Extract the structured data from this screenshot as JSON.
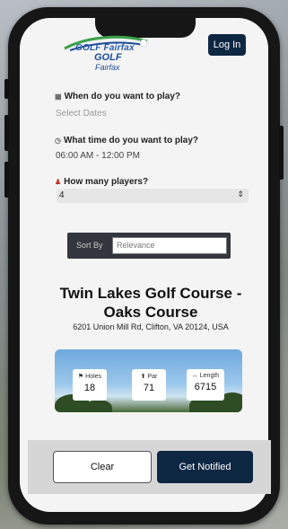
{
  "header": {
    "logo_line1": "GOLF Fairfax",
    "logo_line2": "GOLF",
    "logo_line3": "Fairfax",
    "login_label": "Log In"
  },
  "form": {
    "date_label": "When do you want to play?",
    "date_placeholder": "Select Dates",
    "time_label": "What time do you want to play?",
    "time_value": "06:00 AM - 12:00 PM",
    "players_label": "How many players?",
    "players_value": "4"
  },
  "sort": {
    "label": "Sort By",
    "value": "Relevance"
  },
  "course": {
    "title": "Twin Lakes Golf Course - Oaks Course",
    "address": "6201 Union Mill Rd, Clifton, VA 20124, USA",
    "stats": [
      {
        "icon": "flag-icon",
        "glyph": "⚑",
        "label": "Holes",
        "value": "18"
      },
      {
        "icon": "golf-tee-icon",
        "glyph": "⬆",
        "label": "Par",
        "value": "71"
      },
      {
        "icon": "ruler-icon",
        "glyph": "↔",
        "label": "Length",
        "value": "6715"
      }
    ]
  },
  "footer": {
    "clear_label": "Clear",
    "notify_label": "Get Notified"
  },
  "colors": {
    "navy": "#0d2743",
    "logo_blue": "#1f4c9a",
    "logo_green": "#3aa047"
  }
}
